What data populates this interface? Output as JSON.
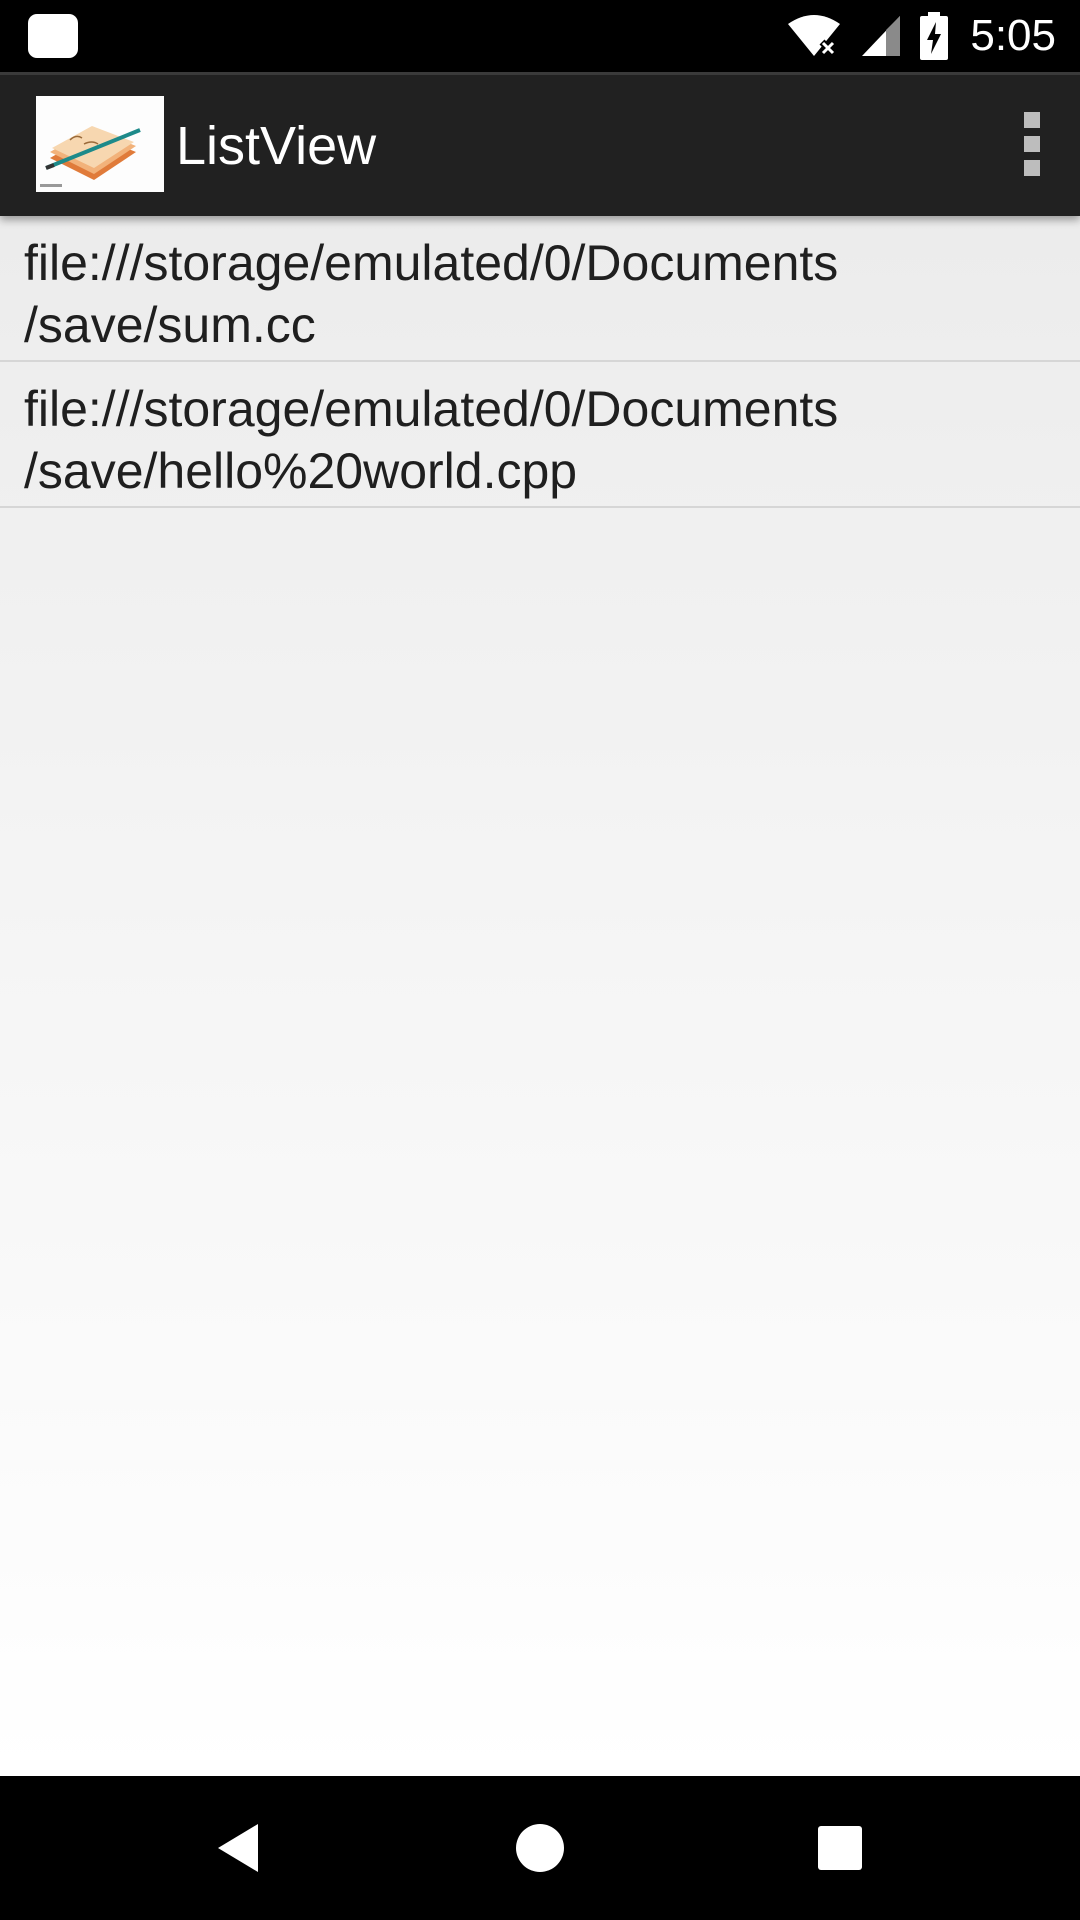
{
  "status_bar": {
    "time": "5:05",
    "icons": [
      "notification-icon",
      "wifi-icon",
      "signal-icon",
      "battery-charging-icon"
    ]
  },
  "toolbar": {
    "title": "ListView",
    "app_icon": "notepad-pencil-icon",
    "menu_icon": "overflow-menu-icon"
  },
  "list": {
    "items": [
      {
        "line1": "file:///storage/emulated/0/Documents",
        "line2": "/save/sum.cc"
      },
      {
        "line1": "file:///storage/emulated/0/Documents",
        "line2": "/save/hello%20world.cpp"
      }
    ]
  },
  "nav_bar": {
    "buttons": [
      "back-icon",
      "home-icon",
      "recents-icon"
    ]
  },
  "colors": {
    "toolbar": "#212121",
    "status_bar": "#000000",
    "content_top": "#ececec",
    "content_bottom": "#ffffff",
    "text": "#1f1f1f"
  }
}
